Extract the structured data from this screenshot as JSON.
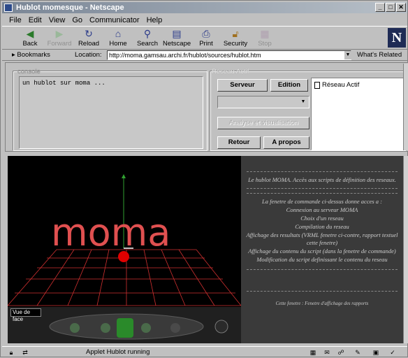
{
  "window": {
    "title": "Hublot momesque - Netscape"
  },
  "menu": {
    "items": [
      "File",
      "Edit",
      "View",
      "Go",
      "Communicator",
      "Help"
    ]
  },
  "toolbar": {
    "buttons": [
      {
        "label": "Back",
        "icon": "back-arrow-icon"
      },
      {
        "label": "Forward",
        "icon": "forward-arrow-icon"
      },
      {
        "label": "Reload",
        "icon": "reload-icon"
      },
      {
        "label": "Home",
        "icon": "home-icon"
      },
      {
        "label": "Search",
        "icon": "search-icon"
      },
      {
        "label": "Netscape",
        "icon": "netscape-icon"
      },
      {
        "label": "Print",
        "icon": "print-icon"
      },
      {
        "label": "Security",
        "icon": "lock-icon"
      },
      {
        "label": "Stop",
        "icon": "stop-icon"
      }
    ],
    "logo": "N"
  },
  "location": {
    "bookmarks": "Bookmarks",
    "label": "Location:",
    "url": "http://moma.gamsau.archi.fr/hublot/sources/hublot.htm",
    "related": "What's Related"
  },
  "console": {
    "label": "console",
    "text": "un hublot sur moma ..."
  },
  "reseau": {
    "label": "Réseau Actif",
    "serveur": "Serveur",
    "edition": "Edition",
    "analyse": "Analyse et visualisation",
    "retour": "Retour",
    "apropos": "A propos",
    "list_item": "Réseau Actif"
  },
  "view3d": {
    "text": "moma",
    "vue_button": "Vue de face"
  },
  "info": {
    "intro": "Le hublot MOMA. Accès aux scripts de définition des reseaux.",
    "lines": [
      "La fenetre de commande ci-dessus donne acces a :",
      "Connexion au serveur MOMA",
      "Choix d'un reseau",
      "Compilation du reseau",
      "Affichage des resultats (VRML fenetre ci-contre, rapport textuel cette fenetre)",
      "Affichage du contenu du script (dans la fenetre de commande)",
      "Modification du script definissant le contenu du reseau"
    ],
    "footer": "Cette fenetre : Fenetre d'affichage des rapports"
  },
  "status": {
    "text": "Applet Hublot running"
  }
}
